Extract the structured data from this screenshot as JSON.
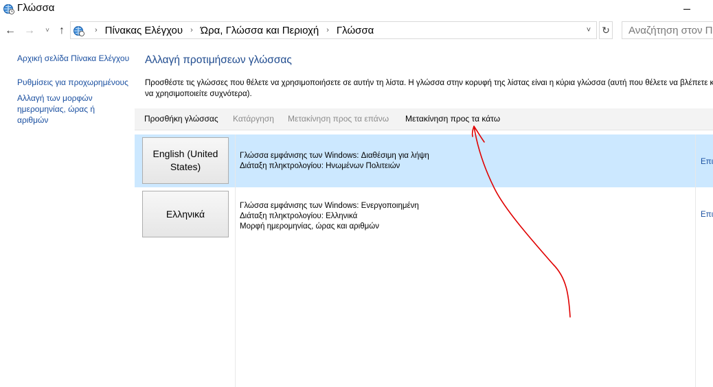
{
  "window": {
    "title": "Γλώσσα",
    "title_icon": "globe-clock-icon"
  },
  "nav": {
    "back_icon": "←",
    "forward_icon": "→",
    "recent_icon": "˅",
    "up_icon": "↑",
    "breadcrumb": [
      "Πίνακας Ελέγχου",
      "Ώρα, Γλώσσα και Περιοχή",
      "Γλώσσα"
    ],
    "separator": "›",
    "dropdown_icon": "˅",
    "refresh_icon": "↻",
    "search_placeholder": "Αναζήτηση στον Πίνακα Ελέγχου"
  },
  "sidebar": {
    "links": [
      "Αρχική σελίδα Πίνακα Ελέγχου",
      "Ρυθμίσεις για προχωρημένους",
      "Αλλαγή των μορφών ημερομηνίας, ώρας ή αριθμών"
    ]
  },
  "main": {
    "heading": "Αλλαγή προτιμήσεων γλώσσας",
    "description": "Προσθέστε τις γλώσσες που θέλετε να χρησιμοποιήσετε σε αυτήν τη λίστα. Η γλώσσα στην κορυφή της λίστας είναι η κύρια γλώσσα (αυτή που θέλετε να βλέπετε και να χρησιμοποιείτε συχνότερα).",
    "toolbar": {
      "add": "Προσθήκη γλώσσας",
      "remove": "Κατάργηση",
      "move_up": "Μετακίνηση προς τα επάνω",
      "move_down": "Μετακίνηση προς τα κάτω"
    },
    "languages": [
      {
        "name": "English (United States)",
        "line1": "Γλώσσα εμφάνισης των Windows: Διαθέσιμη για λήψη",
        "line2": "Διάταξη πληκτρολογίου: Ηνωμένων Πολιτειών",
        "line3": "",
        "options": "Επιλογές",
        "selected": true
      },
      {
        "name": "Ελληνικά",
        "line1": "Γλώσσα εμφάνισης των Windows: Ενεργοποιημένη",
        "line2": "Διάταξη πληκτρολογίου: Ελληνικά",
        "line3": "Μορφή ημερομηνίας, ώρας και αριθμών",
        "options": "Επιλογές",
        "selected": false
      }
    ]
  },
  "colors": {
    "link": "#1a4fa0",
    "heading": "#1e4a8e",
    "selection": "#cce8ff",
    "annotation": "#e00000"
  }
}
